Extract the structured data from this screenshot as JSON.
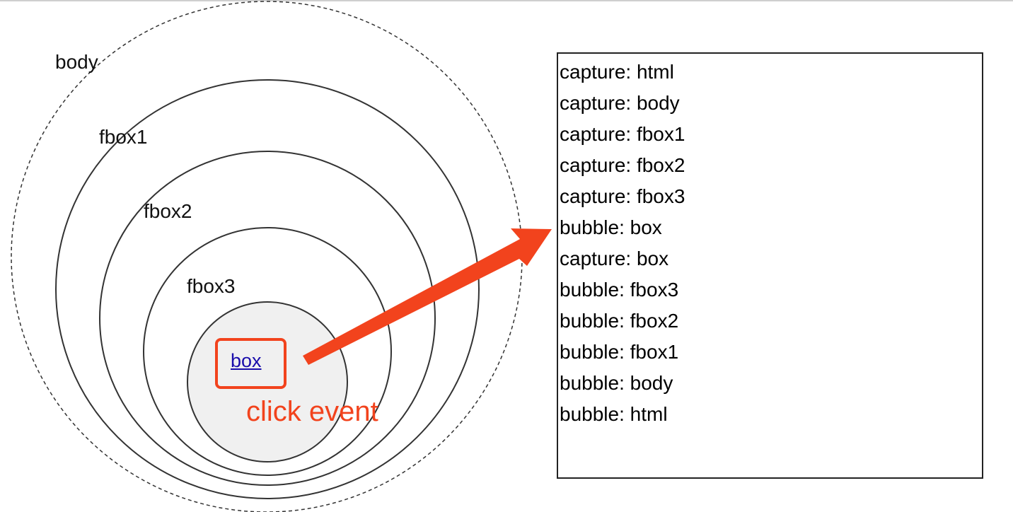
{
  "diagram": {
    "labels": {
      "body": "body",
      "fbox1": "fbox1",
      "fbox2": "fbox2",
      "fbox3": "fbox3"
    },
    "target_link": "box",
    "event_label": "click event",
    "colors": {
      "accent": "#f2431d",
      "link": "#1a0dab",
      "inner_fill": "#f0f0f0",
      "outline": "#333333"
    }
  },
  "log": {
    "entries": [
      "capture: html",
      "capture: body",
      "capture: fbox1",
      "capture: fbox2",
      "capture: fbox3",
      "bubble: box",
      "capture: box",
      "bubble: fbox3",
      "bubble: fbox2",
      "bubble: fbox1",
      "bubble: body",
      "bubble: html"
    ]
  }
}
